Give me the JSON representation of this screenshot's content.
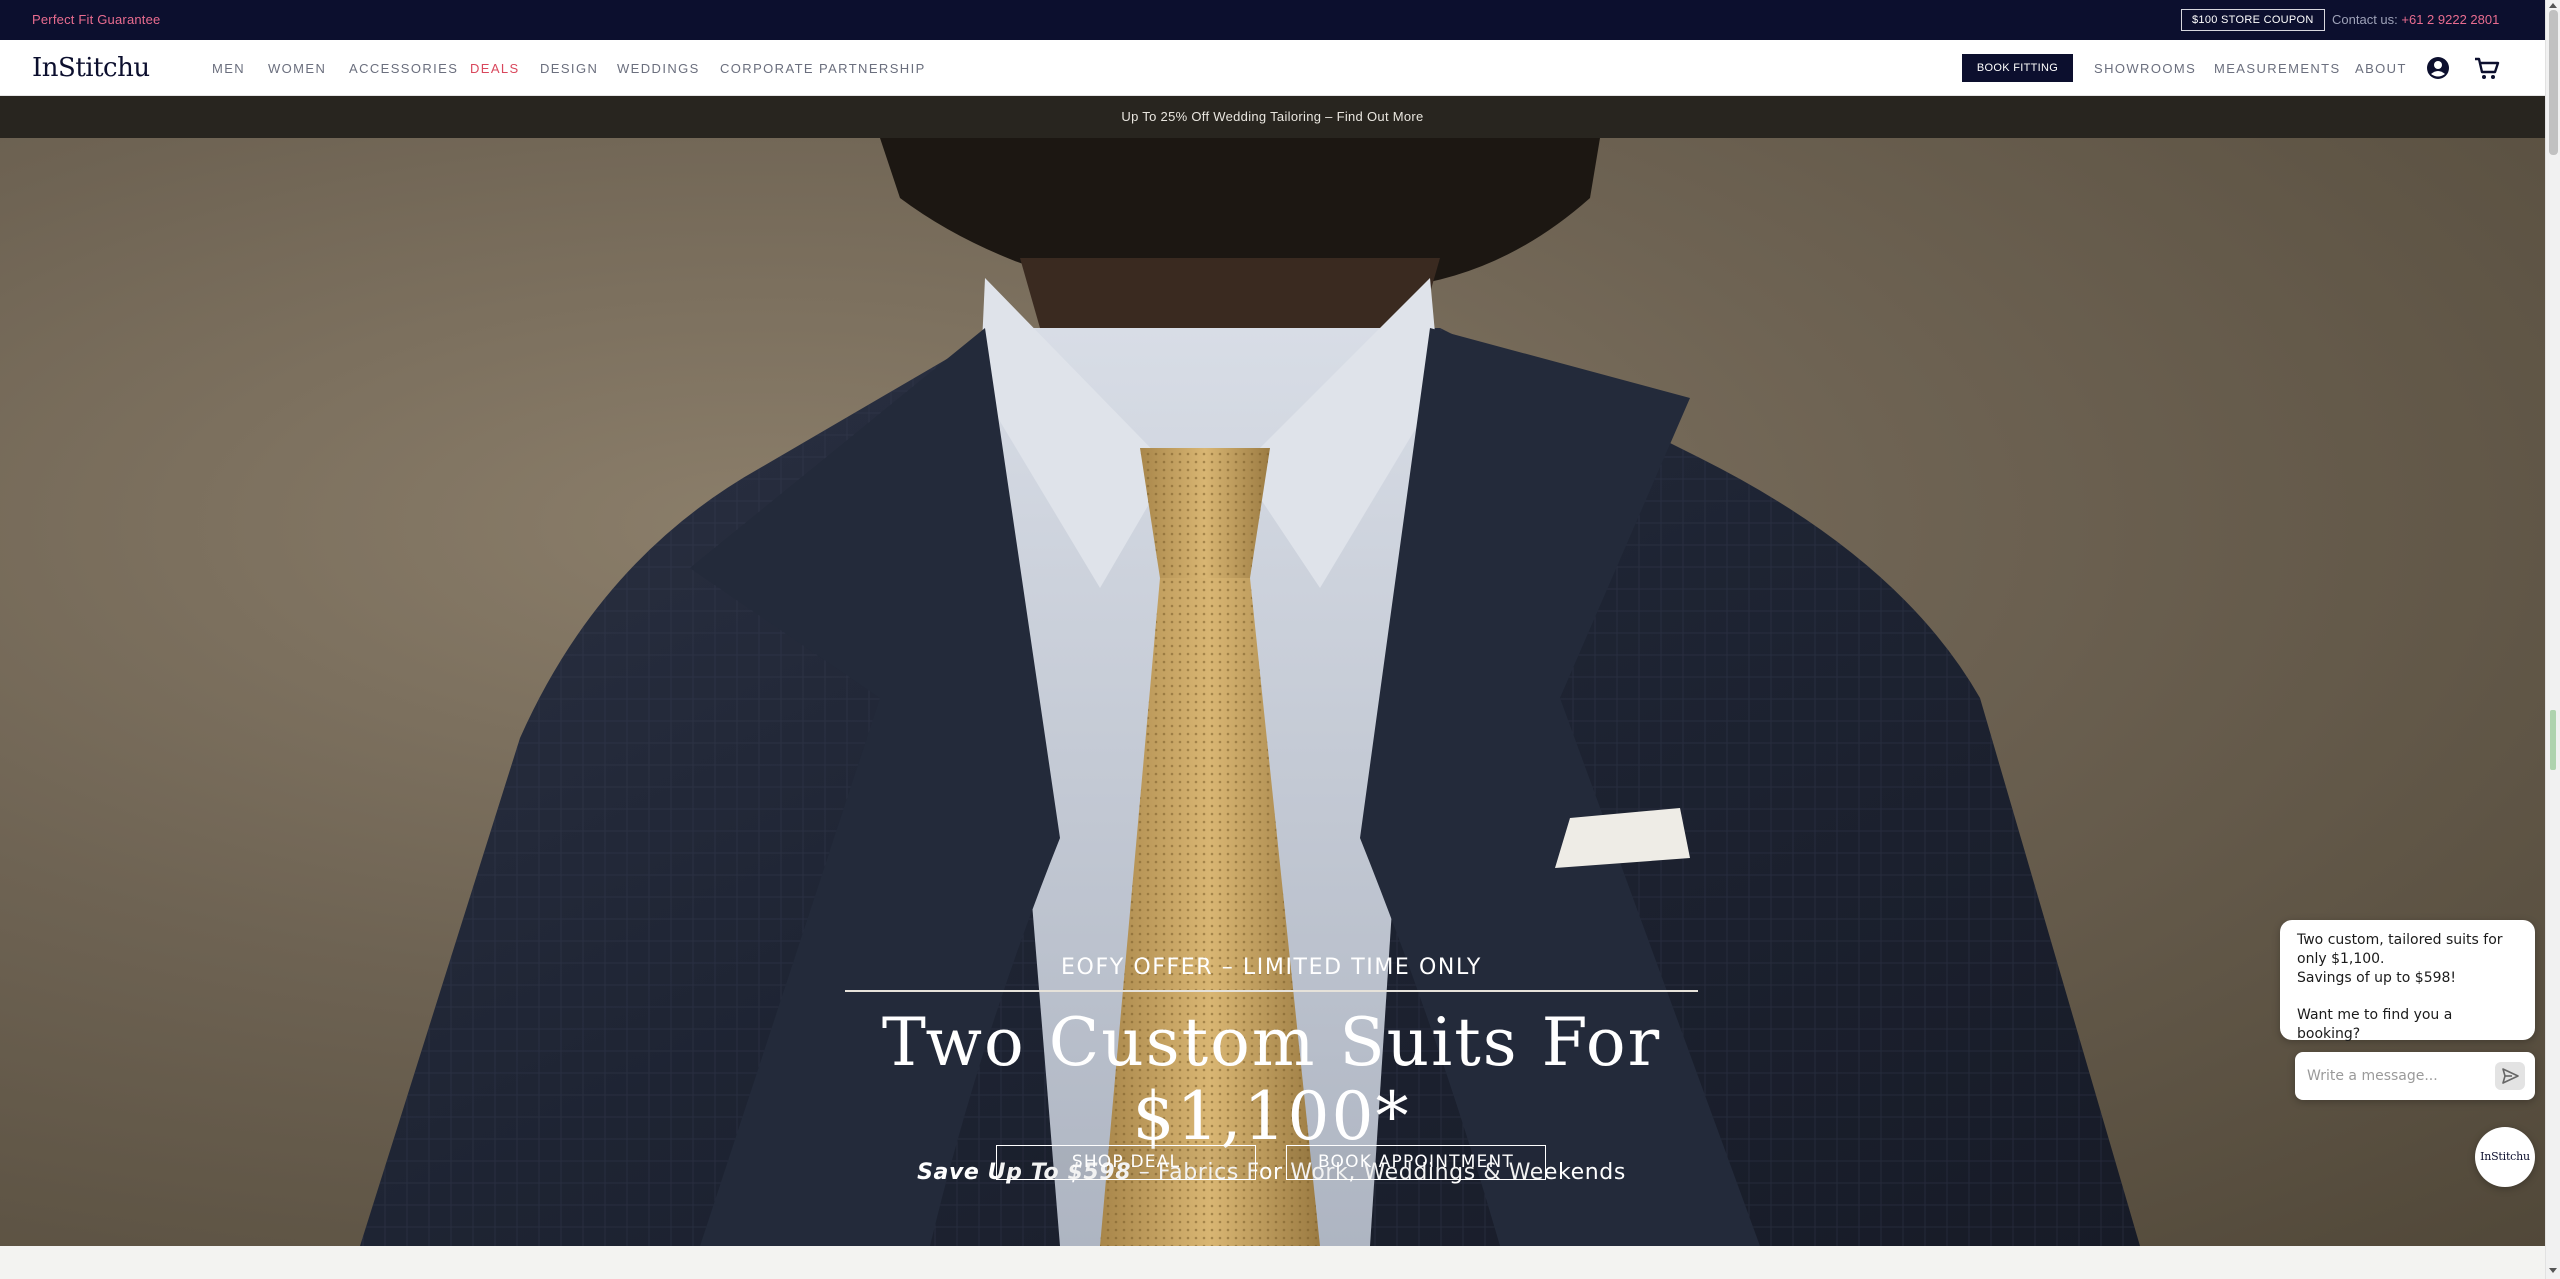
{
  "topbar": {
    "guarantee": "Perfect Fit Guarantee",
    "coupon": "$100 STORE COUPON",
    "contact_label": "Contact us:",
    "contact_phone": "+61 2 9222 2801"
  },
  "nav": {
    "logo": "InStitchu",
    "items": [
      "MEN",
      "WOMEN",
      "ACCESSORIES",
      "DEALS",
      "DESIGN",
      "WEDDINGS",
      "CORPORATE PARTNERSHIP"
    ],
    "book_fitting": "BOOK FITTING",
    "right_items": [
      "SHOWROOMS",
      "MEASUREMENTS",
      "ABOUT"
    ],
    "icons": [
      "account-icon",
      "cart-icon"
    ]
  },
  "promo": {
    "text": "Up To 25% Off Wedding Tailoring – Find Out More"
  },
  "hero": {
    "eyebrow": "EOFY OFFER – LIMITED TIME ONLY",
    "headline": "Two Custom Suits For $1,100*",
    "sub_bold": "Save Up To $598",
    "sub_rest": " – Fabrics For Work, Weddings & Weekends",
    "cta_primary": "SHOP DEAL",
    "cta_secondary": "BOOK APPOINTMENT"
  },
  "chat": {
    "message_line1": "Two custom, tailored suits for only $1,100.",
    "message_line2": "Savings of up to $598!",
    "message_line3": "Want me to find you a booking?",
    "input_placeholder": "Write a message...",
    "avatar_label": "InStitchu"
  },
  "colors": {
    "navy": "#0c0f2e",
    "accent_pink": "#e96c8f",
    "deals_red": "#d9475c"
  }
}
